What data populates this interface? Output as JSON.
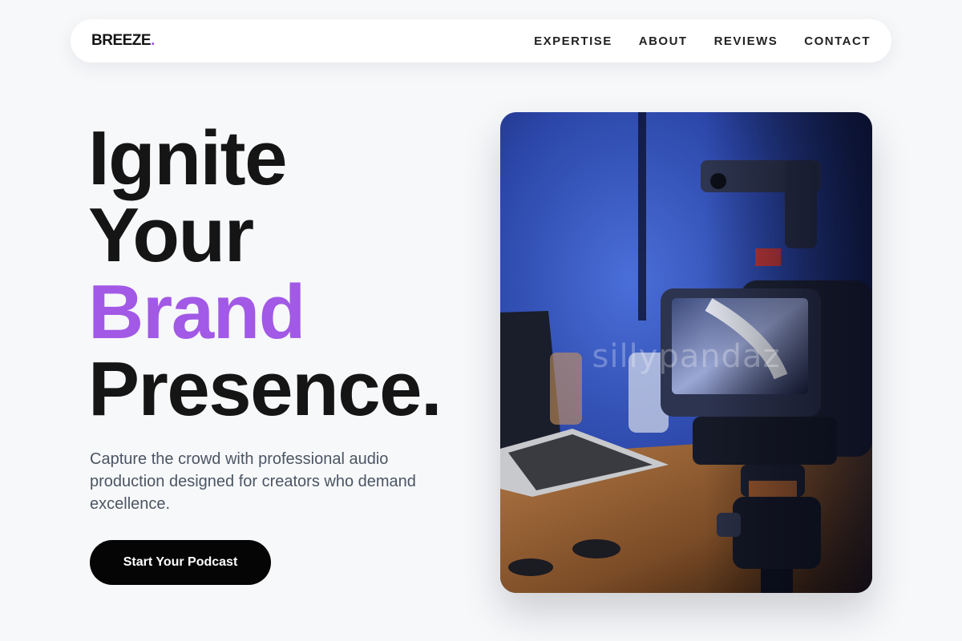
{
  "brand": {
    "name": "BREEZE",
    "dot": ".",
    "accent_color": "#a259e6"
  },
  "nav": {
    "links": [
      "EXPERTISE",
      "ABOUT",
      "REVIEWS",
      "CONTACT"
    ]
  },
  "hero": {
    "headline": [
      "Ignite",
      "Your",
      "Brand",
      "Presence."
    ],
    "subtext": "Capture the crowd with professional audio production designed for creators who demand excellence.",
    "cta_label": "Start Your Podcast"
  },
  "photo": {
    "subject": "camera-on-tripod-desk-photo",
    "watermark": "sillypandaz"
  }
}
